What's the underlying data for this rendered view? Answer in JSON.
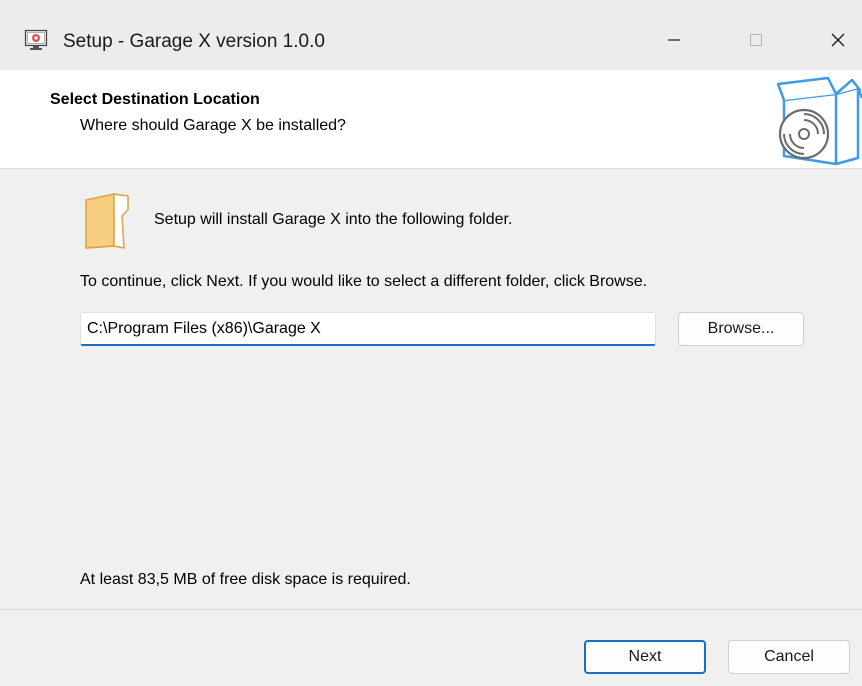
{
  "window": {
    "title": "Setup - Garage X version 1.0.0",
    "app_icon": "setup-computer-icon",
    "controls": {
      "minimize": "—",
      "maximize": "☐",
      "close": "✕"
    }
  },
  "header": {
    "title": "Select Destination Location",
    "subtitle": "Where should Garage X be installed?",
    "graphic": "install-box-disc-icon"
  },
  "body": {
    "folder_icon": "folder-icon",
    "folder_text": "Setup will install Garage X into the following folder.",
    "continue_text": "To continue, click Next. If you would like to select a different folder, click Browse.",
    "path_value": "C:\\Program Files (x86)\\Garage X",
    "browse_label": "Browse...",
    "disk_space_text": "At least 83,5 MB of free disk space is required."
  },
  "footer": {
    "next_label": "Next",
    "cancel_label": "Cancel"
  },
  "colors": {
    "accent": "#1a6fbf",
    "folder": "#f5c76e",
    "box": "#3d9be9"
  }
}
